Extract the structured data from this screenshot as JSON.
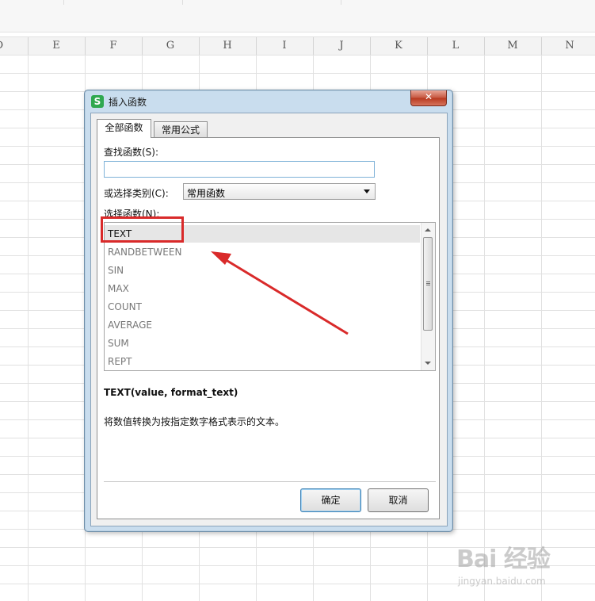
{
  "spreadsheet": {
    "columns": [
      "D",
      "E",
      "F",
      "G",
      "H",
      "I",
      "J",
      "K",
      "L",
      "M",
      "N"
    ]
  },
  "dialog": {
    "title": "插入函数",
    "app_icon_glyph": "S",
    "close_glyph": "✕",
    "tabs": [
      {
        "label": "全部函数",
        "active": true
      },
      {
        "label": "常用公式",
        "active": false
      }
    ],
    "search_label": "查找函数(S):",
    "search_value": "",
    "category_label": "或选择类别(C):",
    "category_value": "常用函数",
    "function_list_label": "选择函数(N):",
    "functions": [
      "TEXT",
      "RANDBETWEEN",
      "SIN",
      "MAX",
      "COUNT",
      "AVERAGE",
      "SUM",
      "REPT"
    ],
    "selected_function": "TEXT",
    "signature": "TEXT(value, format_text)",
    "description": "将数值转换为按指定数字格式表示的文本。",
    "ok_label": "确定",
    "cancel_label": "取消"
  },
  "annotation": {
    "highlight_color": "#d92a2a"
  },
  "watermark": {
    "brand": "Bai 经验",
    "url": "jingyan.baidu.com"
  }
}
